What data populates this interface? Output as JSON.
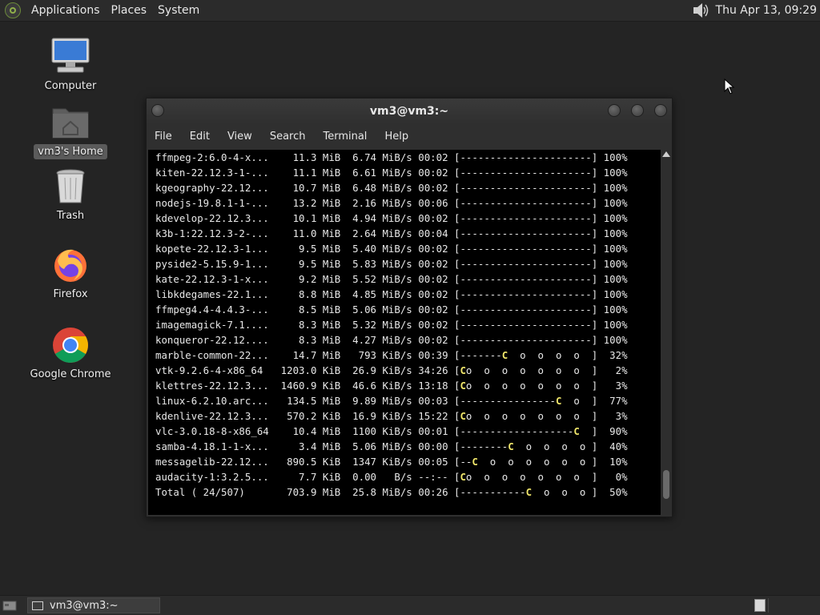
{
  "top_panel": {
    "menus": [
      "Applications",
      "Places",
      "System"
    ],
    "clock": "Thu Apr 13, 09:29"
  },
  "desktop": {
    "icons": [
      {
        "label": "Computer",
        "icon": "computer-icon"
      },
      {
        "label": "vm3's Home",
        "icon": "home-folder-icon"
      },
      {
        "label": "Trash",
        "icon": "trash-icon"
      },
      {
        "label": "Firefox",
        "icon": "firefox-icon"
      },
      {
        "label": "Google Chrome",
        "icon": "chrome-icon"
      }
    ]
  },
  "window": {
    "title": "vm3@vm3:~",
    "menus": [
      "File",
      "Edit",
      "View",
      "Search",
      "Terminal",
      "Help"
    ]
  },
  "terminal": {
    "lines": [
      "ffmpeg-2:6.0-4-x...    11.3 MiB  6.74 MiB/s 00:02 [----------------------] 100%",
      "kiten-22.12.3-1-...    11.1 MiB  6.61 MiB/s 00:02 [----------------------] 100%",
      "kgeography-22.12...    10.7 MiB  6.48 MiB/s 00:02 [----------------------] 100%",
      "nodejs-19.8.1-1-...    13.2 MiB  2.16 MiB/s 00:06 [----------------------] 100%",
      "kdevelop-22.12.3...    10.1 MiB  4.94 MiB/s 00:02 [----------------------] 100%",
      "k3b-1:22.12.3-2-...    11.0 MiB  2.64 MiB/s 00:04 [----------------------] 100%",
      "kopete-22.12.3-1...     9.5 MiB  5.40 MiB/s 00:02 [----------------------] 100%",
      "pyside2-5.15.9-1...     9.5 MiB  5.83 MiB/s 00:02 [----------------------] 100%",
      "kate-22.12.3-1-x...     9.2 MiB  5.52 MiB/s 00:02 [----------------------] 100%",
      "libkdegames-22.1...     8.8 MiB  4.85 MiB/s 00:02 [----------------------] 100%",
      "ffmpeg4.4-4.4.3-...     8.5 MiB  5.06 MiB/s 00:02 [----------------------] 100%",
      "imagemagick-7.1....     8.3 MiB  5.32 MiB/s 00:02 [----------------------] 100%",
      "konqueror-22.12....     8.3 MiB  4.27 MiB/s 00:02 [----------------------] 100%",
      "marble-common-22...    14.7 MiB   793 KiB/s 00:39 [-------C  o  o  o  o  ]  32%",
      "vtk-9.2.6-4-x86_64   1203.0 KiB  26.9 KiB/s 34:26 [Co  o  o  o  o  o  o  ]   2%",
      "klettres-22.12.3...  1460.9 KiB  46.6 KiB/s 13:18 [Co  o  o  o  o  o  o  ]   3%",
      "linux-6.2.10.arc...   134.5 MiB  9.89 MiB/s 00:03 [----------------C  o  ]  77%",
      "kdenlive-22.12.3...   570.2 KiB  16.9 KiB/s 15:22 [Co  o  o  o  o  o  o  ]   3%",
      "vlc-3.0.18-8-x86_64    10.4 MiB  1100 KiB/s 00:01 [-------------------C  ]  90%",
      "samba-4.18.1-1-x...     3.4 MiB  5.06 MiB/s 00:00 [--------C  o  o  o  o ]  40%",
      "messagelib-22.12...   890.5 KiB  1347 KiB/s 00:05 [--C  o  o  o  o  o  o ]  10%",
      "audacity-1:3.2.5...     7.7 KiB  0.00   B/s --:-- [Co  o  o  o  o  o  o  ]   0%",
      "Total ( 24/507)       703.9 MiB  25.8 MiB/s 00:26 [-----------C  o  o  o ]  50%"
    ]
  },
  "taskbar": {
    "task_label": "vm3@vm3:~"
  }
}
